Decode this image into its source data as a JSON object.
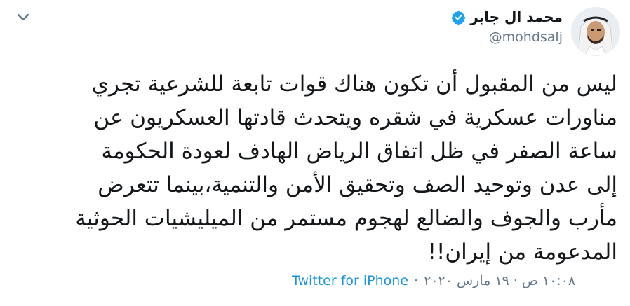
{
  "user": {
    "name": "محمد ال جابر",
    "handle": "@mohdsalj",
    "verified": true
  },
  "tweet": {
    "lines": [
      "ليس من المقبول أن تكون هناك قوات تابعة للشرعية تجري",
      "مناورات عسكرية في شقره ويتحدث قادتها العسكريون عن",
      "ساعة الصفر في ظل اتفاق الرياض الهادف لعودة الحكومة",
      "إلى عدن وتوحيد الصف وتحقيق الأمن والتنمية،بينما تتعرض",
      "مأرب والجوف والضالع لهجوم مستمر من الميليشيات الحوثية",
      "المدعومة من إيران!!"
    ],
    "timestamp": "١٠:٠٨ ص · ١٩ مارس ٢٠٢٠",
    "separator": "·",
    "source": "Twitter for iPhone"
  },
  "icons": {
    "menu": "chevron-down-icon",
    "verified": "verified-badge-icon"
  },
  "colors": {
    "text": "#14171a",
    "secondary": "#657786",
    "link": "#1b95e0",
    "verified": "#1da1f2"
  }
}
